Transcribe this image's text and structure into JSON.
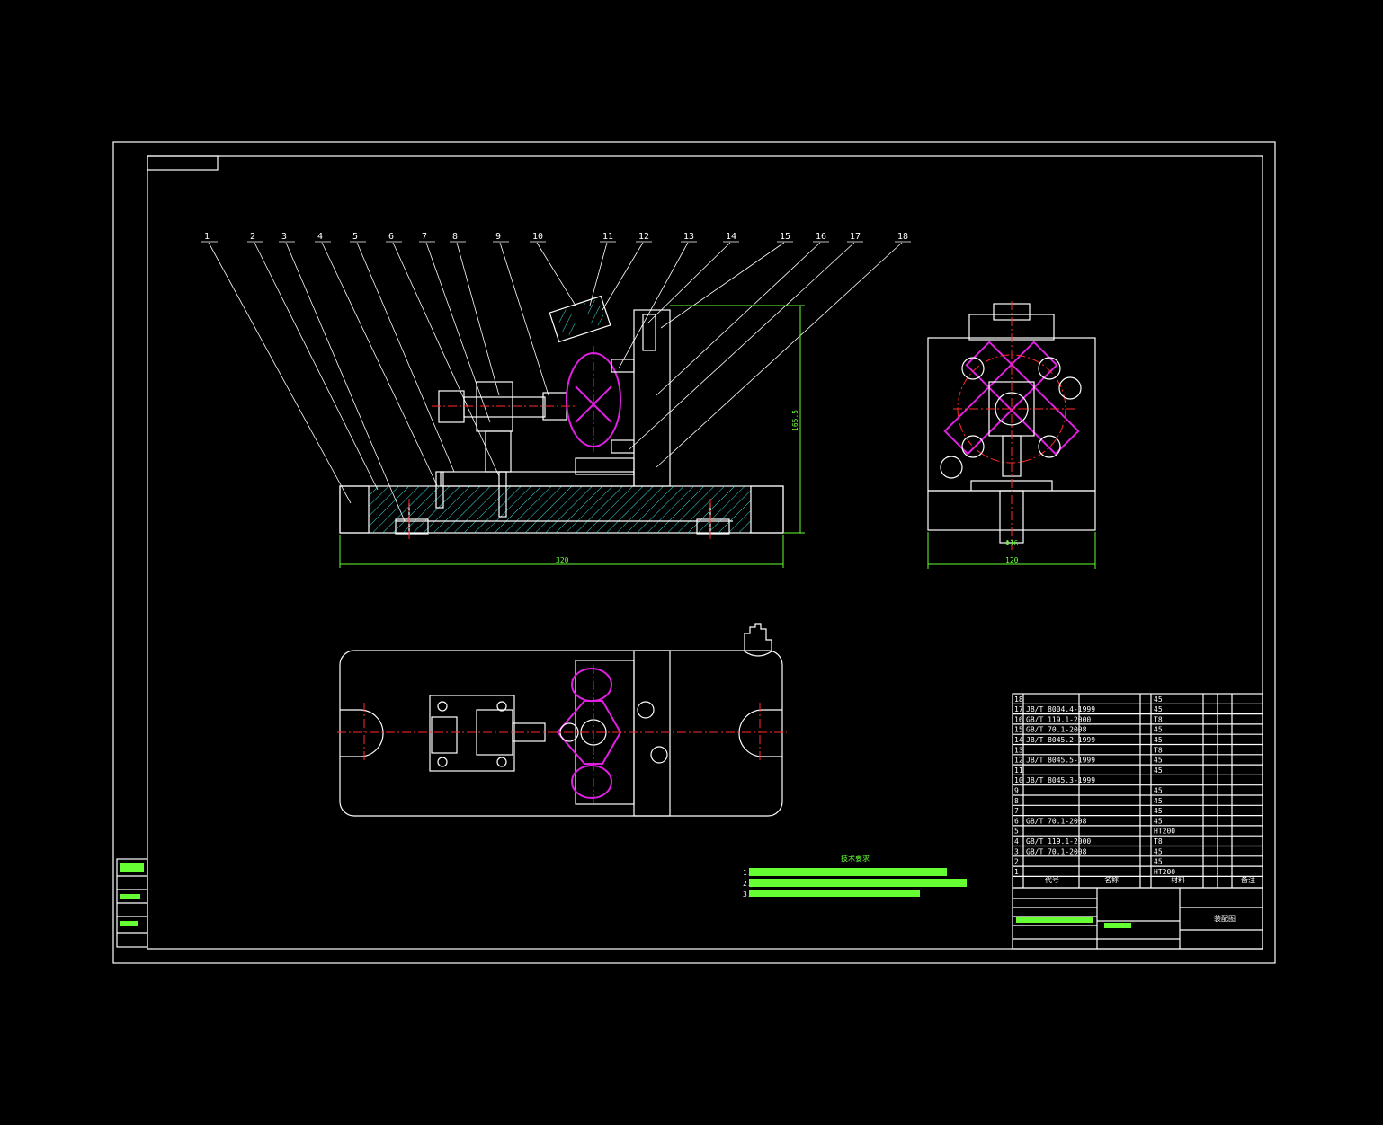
{
  "drawing": {
    "part_numbers": [
      "1",
      "2",
      "3",
      "4",
      "5",
      "6",
      "7",
      "8",
      "9",
      "10",
      "11",
      "12",
      "13",
      "14",
      "15",
      "16",
      "17",
      "18"
    ],
    "dim_width_front": "320",
    "dim_height_front": "165.5",
    "dim_width_side": "120",
    "dim_side_hole": "Φ16",
    "tech_title": "技术要求",
    "tech_items": [
      "1.",
      "2.",
      "3."
    ],
    "drawing_name": "装配图"
  },
  "bom": {
    "header": {
      "code": "代号",
      "name": "名称",
      "qty": "",
      "material": "材料",
      "remark": "备注"
    },
    "rows": [
      {
        "no": "18",
        "code": "",
        "material": "45"
      },
      {
        "no": "17",
        "code": "JB/T 8004.4-1999",
        "material": "45"
      },
      {
        "no": "16",
        "code": "GB/T 119.1-2000",
        "material": "T8"
      },
      {
        "no": "15",
        "code": "GB/T 70.1-2008",
        "material": "45"
      },
      {
        "no": "14",
        "code": "JB/T 8045.2-1999",
        "material": "45"
      },
      {
        "no": "13",
        "code": "",
        "material": "T8"
      },
      {
        "no": "12",
        "code": "JB/T 8045.5-1999",
        "material": "45"
      },
      {
        "no": "11",
        "code": "",
        "material": "45"
      },
      {
        "no": "10",
        "code": "JB/T 8045.3-1999",
        "material": ""
      },
      {
        "no": "9",
        "code": "",
        "material": "45"
      },
      {
        "no": "8",
        "code": "",
        "material": "45"
      },
      {
        "no": "7",
        "code": "",
        "material": "45"
      },
      {
        "no": "6",
        "code": "GB/T 70.1-2008",
        "material": "45"
      },
      {
        "no": "5",
        "code": "",
        "material": "HT200"
      },
      {
        "no": "4",
        "code": "GB/T 119.1-2000",
        "material": "T8"
      },
      {
        "no": "3",
        "code": "GB/T 70.1-2008",
        "material": "45"
      },
      {
        "no": "2",
        "code": "",
        "material": "45"
      },
      {
        "no": "1",
        "code": "",
        "material": "HT200"
      }
    ]
  },
  "colors": {
    "background": "#000000",
    "line": "#ffffff",
    "hatch": "#33e0e0",
    "dimension": "#66ff33",
    "center": "#ff2a2a",
    "workpiece": "#e020e0"
  }
}
